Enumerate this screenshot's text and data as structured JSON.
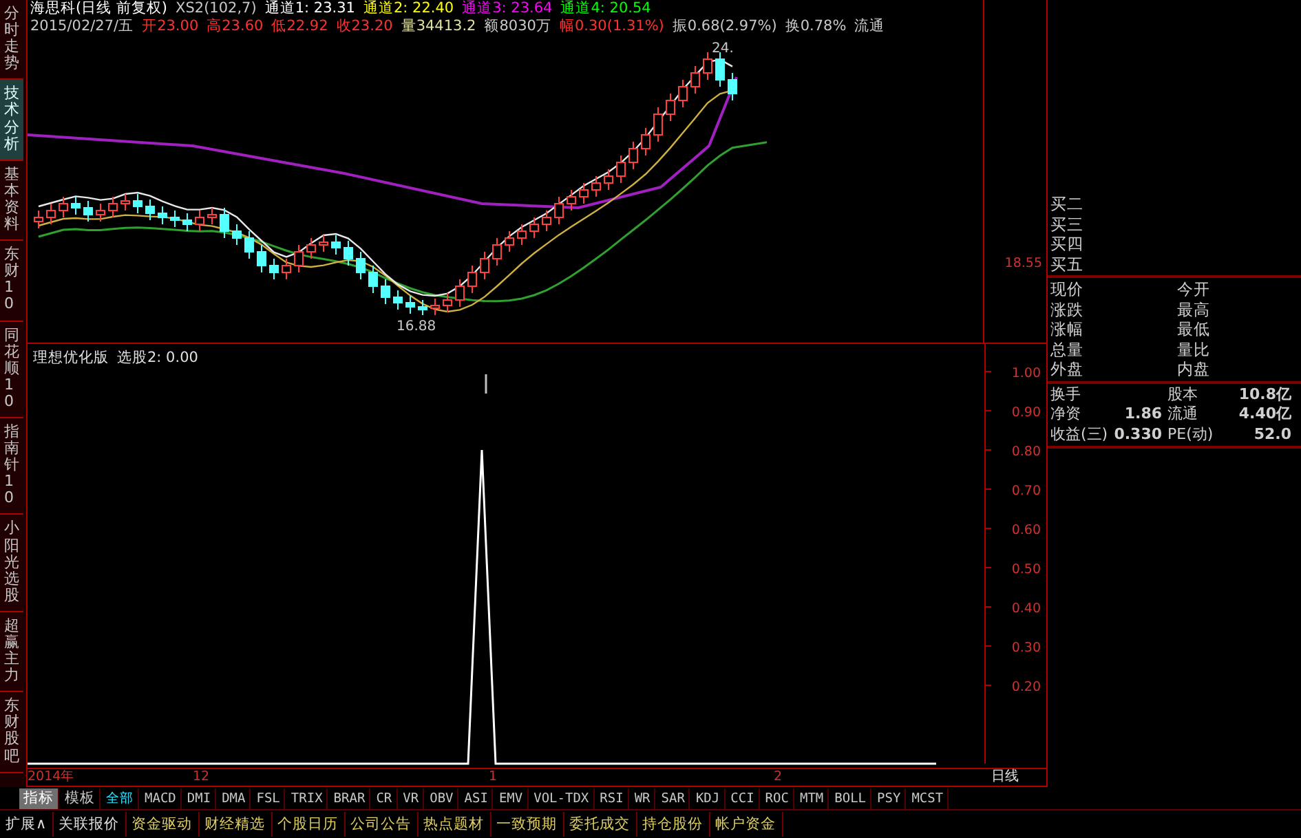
{
  "sidebar": {
    "tabs": [
      {
        "label": "分时走势",
        "selected": false
      },
      {
        "label": "技术分析",
        "selected": true
      },
      {
        "label": "基本资料",
        "selected": false
      },
      {
        "label": "东财10",
        "selected": false
      },
      {
        "label": "同花顺10",
        "selected": false
      },
      {
        "label": "指南针10",
        "selected": false
      },
      {
        "label": "小阳光选股",
        "selected": false
      },
      {
        "label": "超赢主力",
        "selected": false
      },
      {
        "label": "东财股吧",
        "selected": false
      }
    ]
  },
  "price_chart": {
    "header_line_1": [
      {
        "text": "海思科(日线 前复权)",
        "color": "#ffffff"
      },
      {
        "text": "XS2(102,7)",
        "color": "#c8c8c8"
      },
      {
        "text": "通道1: 23.31",
        "color": "#ffffff"
      },
      {
        "text": "通道2: 22.40",
        "color": "#ffff00"
      },
      {
        "text": "通道3: 23.64",
        "color": "#ff00ff"
      },
      {
        "text": "通道4: 20.54",
        "color": "#00ff00"
      }
    ],
    "header_line_2": [
      {
        "text": "2015/02/27/五",
        "color": "#c8c8c8"
      },
      {
        "text": "开23.00",
        "color": "#ff3030"
      },
      {
        "text": "高23.60",
        "color": "#ff3030"
      },
      {
        "text": "低22.92",
        "color": "#ff3030"
      },
      {
        "text": "收23.20",
        "color": "#ff3030"
      },
      {
        "text": "量34413.2",
        "color": "#e0e0a0"
      },
      {
        "text": "额8030万",
        "color": "#c8c8c8"
      },
      {
        "text": "幅0.30(1.31%)",
        "color": "#ff3030"
      },
      {
        "text": "振0.68(2.97%)",
        "color": "#c8c8c8"
      },
      {
        "text": "换0.78%",
        "color": "#c8c8c8"
      },
      {
        "text": "流通",
        "color": "#c8c8c8"
      }
    ],
    "high_label": "24.",
    "low_label": "16.88",
    "axis_label": "18.55"
  },
  "indicator": {
    "title": "理想优化版",
    "reading": ": 0.00",
    "chart_data": {
      "type": "line",
      "ylim": [
        0,
        1
      ],
      "yticks": [
        {
          "value": 1,
          "label": "1.00"
        },
        {
          "value": 0.9,
          "label": "0.90"
        },
        {
          "value": 0.8,
          "label": "0.80"
        },
        {
          "value": 0.7,
          "label": "0.70"
        },
        {
          "value": 0.6,
          "label": "0.60"
        },
        {
          "value": 0.5,
          "label": "0.50"
        },
        {
          "value": 0.4,
          "label": "0.40"
        },
        {
          "value": 0.3,
          "label": "0.30"
        },
        {
          "value": 0.2,
          "label": "0.20"
        }
      ],
      "series": [
        {
          "name": "选股2",
          "color": "#ffffff",
          "values": [
            0,
            0,
            0,
            0,
            0,
            0,
            0,
            0,
            0,
            0,
            0,
            0,
            0,
            0,
            0,
            0,
            0,
            0,
            0,
            0,
            0,
            0,
            0,
            0,
            0,
            0,
            0,
            0,
            0,
            0,
            0,
            0,
            0,
            0.8,
            0,
            0,
            0,
            0,
            0,
            0,
            0,
            0,
            0,
            0,
            0,
            0,
            0,
            0,
            0,
            0,
            0,
            0,
            0,
            0,
            0,
            0,
            0,
            0,
            0,
            0,
            0,
            0,
            0,
            0,
            0,
            0,
            0
          ]
        }
      ]
    }
  },
  "x_axis_labels": [
    "2014年",
    "12",
    "1",
    "2"
  ],
  "period_label": "日线",
  "quote_panel": {
    "order_book": [
      "买二",
      "买三",
      "买四",
      "买五"
    ],
    "quote_rows": [
      {
        "left": "现价",
        "right": "今开"
      },
      {
        "left": "涨跌",
        "right": "最高"
      },
      {
        "left": "涨幅",
        "right": "最低"
      },
      {
        "left": "总量",
        "right": "量比"
      },
      {
        "left": "外盘",
        "right": "内盘"
      }
    ],
    "stats_rows": [
      {
        "label": "换手",
        "label_2": "股本",
        "value_2": "10.8亿"
      },
      {
        "label": "净资",
        "value": "1.86",
        "label_2": "流通",
        "value_2": "4.40亿"
      },
      {
        "label": "收益(三)",
        "value": "0.330",
        "label_2": "PE(动)",
        "value_2": "52.0"
      }
    ]
  },
  "indicator_tabs": [
    {
      "label": "指标",
      "kind": "mode",
      "selected": true
    },
    {
      "label": "模板",
      "kind": "mode",
      "selected": false
    },
    {
      "label": "全部",
      "kind": "formula",
      "selected": true
    },
    {
      "label": "MACD",
      "kind": "formula",
      "selected": false
    },
    {
      "label": "DMI",
      "kind": "formula",
      "selected": false
    },
    {
      "label": "DMA",
      "kind": "formula",
      "selected": false
    },
    {
      "label": "FSL",
      "kind": "formula",
      "selected": false
    },
    {
      "label": "TRIX",
      "kind": "formula",
      "selected": false
    },
    {
      "label": "BRAR",
      "kind": "formula",
      "selected": false
    },
    {
      "label": "CR",
      "kind": "formula",
      "selected": false
    },
    {
      "label": "VR",
      "kind": "formula",
      "selected": false
    },
    {
      "label": "OBV",
      "kind": "formula",
      "selected": false
    },
    {
      "label": "ASI",
      "kind": "formula",
      "selected": false
    },
    {
      "label": "EMV",
      "kind": "formula",
      "selected": false
    },
    {
      "label": "VOL-TDX",
      "kind": "formula",
      "selected": false
    },
    {
      "label": "RSI",
      "kind": "formula",
      "selected": false
    },
    {
      "label": "WR",
      "kind": "formula",
      "selected": false
    },
    {
      "label": "SAR",
      "kind": "formula",
      "selected": false
    },
    {
      "label": "KDJ",
      "kind": "formula",
      "selected": false
    },
    {
      "label": "CCI",
      "kind": "formula",
      "selected": false
    },
    {
      "label": "ROC",
      "kind": "formula",
      "selected": false
    },
    {
      "label": "MTM",
      "kind": "formula",
      "selected": false
    },
    {
      "label": "BOLL",
      "kind": "formula",
      "selected": false
    },
    {
      "label": "PSY",
      "kind": "formula",
      "selected": false
    },
    {
      "label": "MCST",
      "kind": "formula",
      "selected": false
    }
  ],
  "bottom_bar": [
    {
      "label": "扩展∧",
      "kind": "system"
    },
    {
      "label": "关联报价",
      "kind": "system"
    },
    {
      "label": "资金驱动",
      "kind": "module"
    },
    {
      "label": "财经精选",
      "kind": "module"
    },
    {
      "label": "个股日历",
      "kind": "module"
    },
    {
      "label": "公司公告",
      "kind": "module"
    },
    {
      "label": "热点题材",
      "kind": "module"
    },
    {
      "label": "一致预期",
      "kind": "module"
    },
    {
      "label": "委托成交",
      "kind": "module"
    },
    {
      "label": "持仓股份",
      "kind": "module"
    },
    {
      "label": "帐户资金",
      "kind": "module"
    }
  ]
}
